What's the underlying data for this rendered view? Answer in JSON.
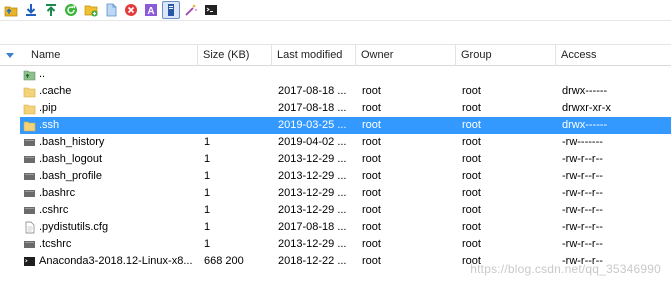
{
  "toolbar": {
    "buttons": [
      {
        "icon": "parent-directory-icon",
        "color": "#e0a000"
      },
      {
        "icon": "download-icon",
        "color": "#1f5fbf"
      },
      {
        "icon": "upload-icon",
        "color": "#1a8a4a"
      },
      {
        "icon": "refresh-icon",
        "color": "#2fa52f"
      },
      {
        "icon": "new-folder-icon",
        "color": "#e7b400"
      },
      {
        "icon": "new-file-icon",
        "color": "#5aa0e0"
      },
      {
        "icon": "delete-icon",
        "color": "#e23b3b"
      },
      {
        "icon": "rename-icon",
        "color": "#8a5ad8"
      },
      {
        "icon": "properties-icon",
        "color": "#2a56a8",
        "active": true
      },
      {
        "icon": "magic-wand-icon",
        "color": "#d05ad8"
      },
      {
        "icon": "terminal-icon",
        "color": "#222222"
      }
    ]
  },
  "columns": {
    "name": "Name",
    "size": "Size (KB)",
    "modified": "Last modified",
    "owner": "Owner",
    "group": "Group",
    "access": "Access"
  },
  "files": [
    {
      "icon": "up-folder-icon",
      "name": "..",
      "size": "",
      "modified": "",
      "owner": "",
      "group": "",
      "access": ""
    },
    {
      "icon": "folder-icon",
      "name": ".cache",
      "size": "",
      "modified": "2017-08-18 ...",
      "owner": "root",
      "group": "root",
      "access": "drwx------"
    },
    {
      "icon": "folder-icon",
      "name": ".pip",
      "size": "",
      "modified": "2017-08-18 ...",
      "owner": "root",
      "group": "root",
      "access": "drwxr-xr-x"
    },
    {
      "icon": "folder-icon",
      "name": ".ssh",
      "size": "",
      "modified": "2019-03-25 ...",
      "owner": "root",
      "group": "root",
      "access": "drwx------",
      "selected": true
    },
    {
      "icon": "file-icon",
      "name": ".bash_history",
      "size": "1",
      "modified": "2019-04-02 ...",
      "owner": "root",
      "group": "root",
      "access": "-rw-------"
    },
    {
      "icon": "file-icon",
      "name": ".bash_logout",
      "size": "1",
      "modified": "2013-12-29 ...",
      "owner": "root",
      "group": "root",
      "access": "-rw-r--r--"
    },
    {
      "icon": "file-icon",
      "name": ".bash_profile",
      "size": "1",
      "modified": "2013-12-29 ...",
      "owner": "root",
      "group": "root",
      "access": "-rw-r--r--"
    },
    {
      "icon": "file-icon",
      "name": ".bashrc",
      "size": "1",
      "modified": "2013-12-29 ...",
      "owner": "root",
      "group": "root",
      "access": "-rw-r--r--"
    },
    {
      "icon": "file-icon",
      "name": ".cshrc",
      "size": "1",
      "modified": "2013-12-29 ...",
      "owner": "root",
      "group": "root",
      "access": "-rw-r--r--"
    },
    {
      "icon": "doc-file-icon",
      "name": ".pydistutils.cfg",
      "size": "1",
      "modified": "2017-08-18 ...",
      "owner": "root",
      "group": "root",
      "access": "-rw-r--r--"
    },
    {
      "icon": "file-icon",
      "name": ".tcshrc",
      "size": "1",
      "modified": "2013-12-29 ...",
      "owner": "root",
      "group": "root",
      "access": "-rw-r--r--"
    },
    {
      "icon": "terminal-file-icon",
      "name": "Anaconda3-2018.12-Linux-x8...",
      "size": "668 200",
      "modified": "2018-12-22 ...",
      "owner": "root",
      "group": "root",
      "access": "-rw-r--r--"
    }
  ],
  "watermark": "https://blog.csdn.net/qq_35346990"
}
